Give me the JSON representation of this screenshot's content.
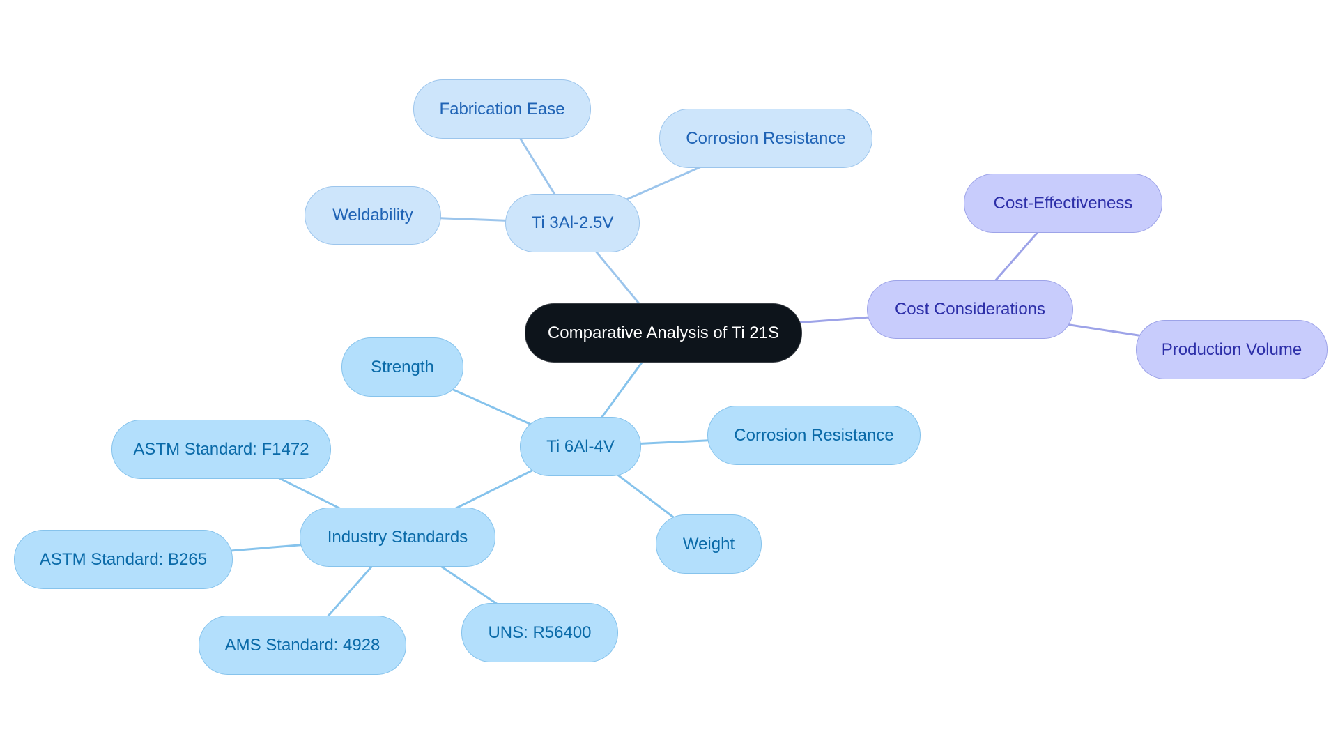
{
  "diagram": {
    "type": "mind-map",
    "root": {
      "id": "root",
      "label": "Comparative Analysis of Ti 21S"
    },
    "colors": {
      "root_fill": "#0d141b",
      "root_text": "#ffffff",
      "branch_ti3al_fill": "#cde5fb",
      "branch_ti3al_text": "#1f63b5",
      "branch_ti3al_edge": "#9cc5ec",
      "branch_cost_fill": "#c8ccfc",
      "branch_cost_text": "#2c2ea8",
      "branch_cost_edge": "#9da3e8",
      "branch_ti6al_fill": "#b3dffc",
      "branch_ti6al_text": "#0a6aa8",
      "branch_ti6al_edge": "#86c3ec"
    },
    "nodes": [
      {
        "id": "ti3al",
        "label": "Ti 3Al-2.5V",
        "parent": "root",
        "branch": "b1"
      },
      {
        "id": "fab",
        "label": "Fabrication Ease",
        "parent": "ti3al",
        "branch": "b1"
      },
      {
        "id": "corr1",
        "label": "Corrosion Resistance",
        "parent": "ti3al",
        "branch": "b1"
      },
      {
        "id": "weld",
        "label": "Weldability",
        "parent": "ti3al",
        "branch": "b1"
      },
      {
        "id": "cost",
        "label": "Cost Considerations",
        "parent": "root",
        "branch": "b2"
      },
      {
        "id": "costeff",
        "label": "Cost-Effectiveness",
        "parent": "cost",
        "branch": "b2"
      },
      {
        "id": "prodvol",
        "label": "Production Volume",
        "parent": "cost",
        "branch": "b2"
      },
      {
        "id": "ti6al",
        "label": "Ti 6Al-4V",
        "parent": "root",
        "branch": "b3"
      },
      {
        "id": "strength",
        "label": "Strength",
        "parent": "ti6al",
        "branch": "b3"
      },
      {
        "id": "corr2",
        "label": "Corrosion Resistance",
        "parent": "ti6al",
        "branch": "b3"
      },
      {
        "id": "weight",
        "label": "Weight",
        "parent": "ti6al",
        "branch": "b3"
      },
      {
        "id": "indstd",
        "label": "Industry Standards",
        "parent": "ti6al",
        "branch": "b3"
      },
      {
        "id": "astmf",
        "label": "ASTM Standard: F1472",
        "parent": "indstd",
        "branch": "b3"
      },
      {
        "id": "astmb",
        "label": "ASTM Standard: B265",
        "parent": "indstd",
        "branch": "b3"
      },
      {
        "id": "ams",
        "label": "AMS Standard: 4928",
        "parent": "indstd",
        "branch": "b3"
      },
      {
        "id": "uns",
        "label": "UNS: R56400",
        "parent": "indstd",
        "branch": "b3"
      }
    ]
  }
}
